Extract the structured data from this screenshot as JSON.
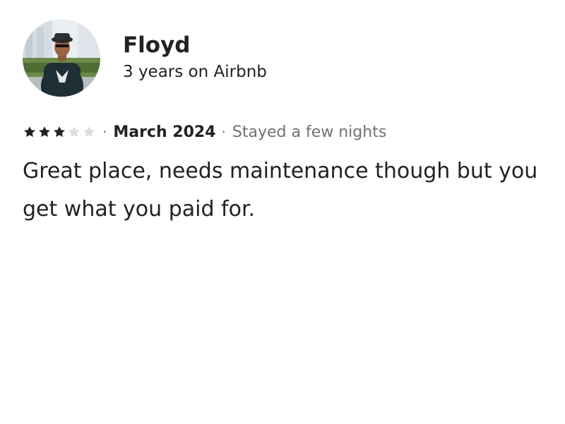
{
  "reviewer": {
    "name": "Floyd",
    "tenure": "3 years on Airbnb"
  },
  "review": {
    "rating": 3,
    "max_rating": 5,
    "separator": "·",
    "date": "March 2024",
    "stay_length": "Stayed a few nights",
    "comment": "Great place, needs maintenance though but you get what you paid for."
  },
  "colors": {
    "star_filled": "#222222",
    "star_empty": "#dddddd",
    "secondary_text": "#717171"
  },
  "icons": {
    "avatar": "profile-photo",
    "star": "star-icon"
  }
}
